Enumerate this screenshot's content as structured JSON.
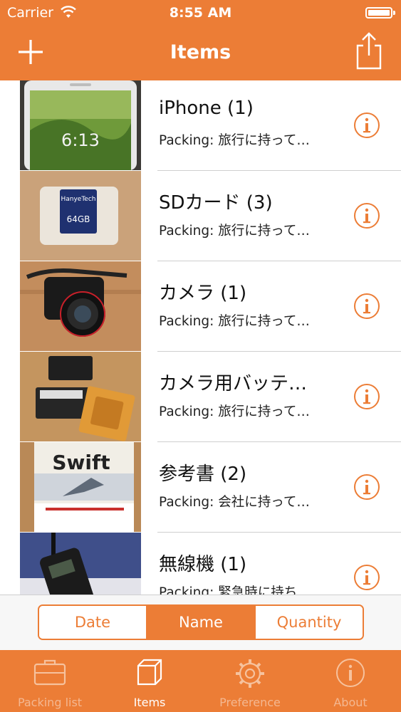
{
  "status_bar": {
    "carrier": "Carrier",
    "time": "8:55 AM"
  },
  "nav": {
    "title": "Items",
    "left_icon": "plus-icon",
    "right_icon": "share-icon"
  },
  "items": [
    {
      "title": "iPhone (1)",
      "subtitle": "Packing: 旅行に持って…",
      "image": "iphone-photo"
    },
    {
      "title": "SDカード (3)",
      "subtitle": "Packing: 旅行に持って…",
      "image": "sd-card-photo"
    },
    {
      "title": "カメラ (1)",
      "subtitle": "Packing: 旅行に持って…",
      "image": "camera-photo"
    },
    {
      "title": "カメラ用バッテ…",
      "subtitle": "Packing: 旅行に持って…",
      "image": "battery-photo"
    },
    {
      "title": "参考書 (2)",
      "subtitle": "Packing: 会社に持って…",
      "image": "book-photo"
    },
    {
      "title": "無線機 (1)",
      "subtitle": "Packing: 緊急時に持ち…",
      "image": "radio-photo"
    }
  ],
  "sort": {
    "options": [
      "Date",
      "Name",
      "Quantity"
    ],
    "selected": "Name"
  },
  "tabs": [
    {
      "label": "Packing list",
      "icon": "suitcase-icon",
      "active": false
    },
    {
      "label": "Items",
      "icon": "box-icon",
      "active": true
    },
    {
      "label": "Preference",
      "icon": "gear-icon",
      "active": false
    },
    {
      "label": "About",
      "icon": "info-icon",
      "active": false
    }
  ],
  "colors": {
    "accent": "#ec7d36",
    "tab_inactive": "#f6c29e"
  }
}
